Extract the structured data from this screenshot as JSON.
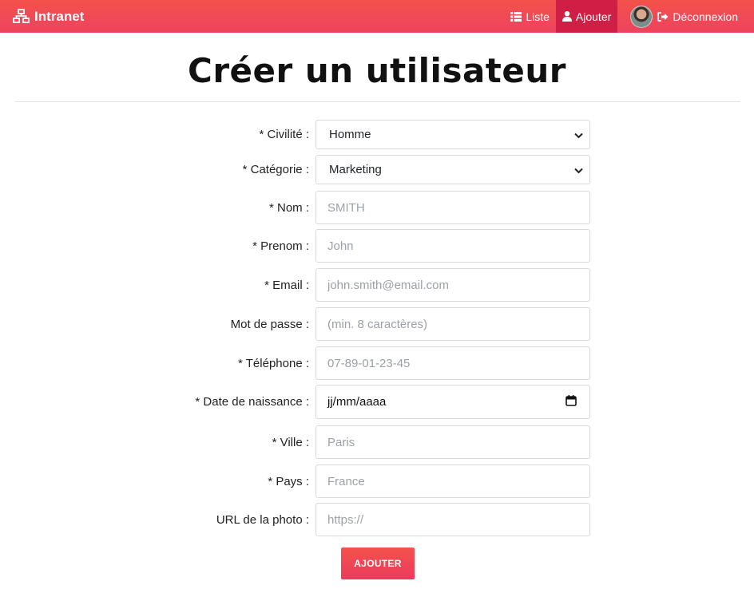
{
  "nav": {
    "brand": "Intranet",
    "links": [
      {
        "label": "Liste",
        "icon": "list-icon"
      },
      {
        "label": "Ajouter",
        "icon": "user-icon"
      }
    ],
    "logout": "Déconnexion",
    "colors": {
      "bar_top": "#f3514a",
      "bar_bottom": "#ee4360",
      "active": "#cf1f44"
    }
  },
  "page": {
    "title": "Créer un utilisateur"
  },
  "form": {
    "civilite": {
      "label": "* Civilité :",
      "value": "Homme"
    },
    "categorie": {
      "label": "* Catégorie :",
      "value": "Marketing"
    },
    "nom": {
      "label": "* Nom :",
      "placeholder": "SMITH"
    },
    "prenom": {
      "label": "* Prenom :",
      "placeholder": "John"
    },
    "email": {
      "label": "* Email :",
      "placeholder": "john.smith@email.com"
    },
    "password": {
      "label": "Mot de passe :",
      "placeholder": "(min. 8 caractères)"
    },
    "telephone": {
      "label": "* Téléphone :",
      "placeholder": "07-89-01-23-45"
    },
    "naissance": {
      "label": "* Date de naissance :",
      "value": "jj/mm/aaaa"
    },
    "ville": {
      "label": "* Ville :",
      "placeholder": "Paris"
    },
    "pays": {
      "label": "* Pays :",
      "placeholder": "France"
    },
    "photo": {
      "label": "URL de la photo :",
      "placeholder": "https://"
    },
    "submit": "AJOUTER"
  }
}
